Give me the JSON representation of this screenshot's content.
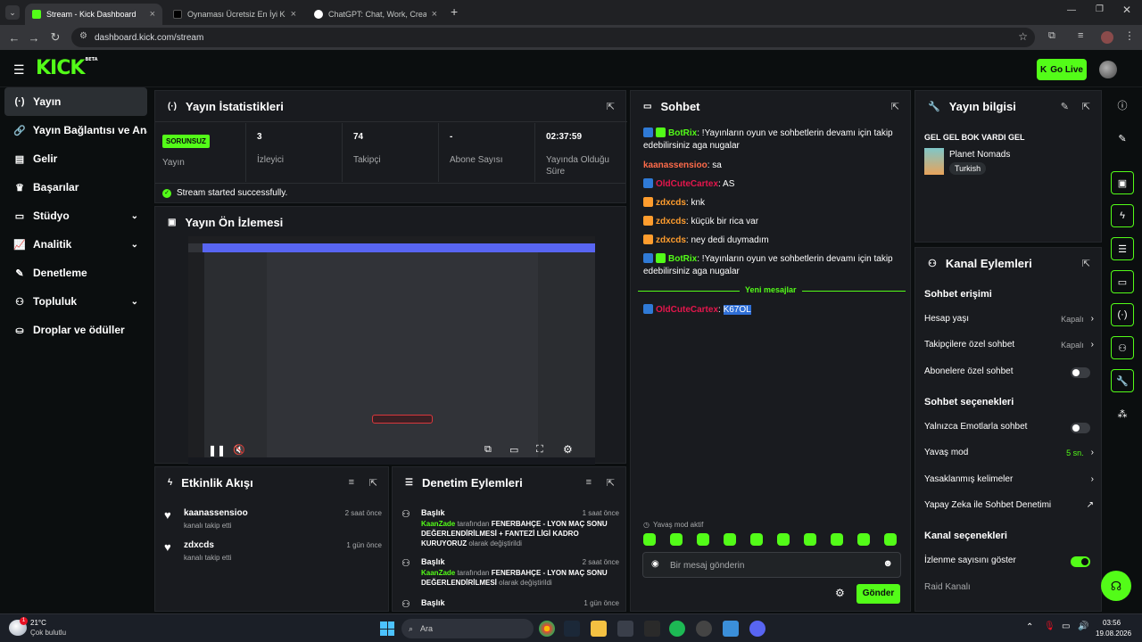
{
  "browser": {
    "tabs": [
      {
        "title": "Stream - Kick Dashboard",
        "active": true,
        "color": "#53fc18"
      },
      {
        "title": "Oynaması Ücretsiz En İyi Korku Oy...",
        "active": false,
        "color": "#111111"
      },
      {
        "title": "ChatGPT: Chat, Work, Create & Lea...",
        "active": false,
        "color": "#ffffff"
      }
    ],
    "url": "dashboard.kick.com/stream"
  },
  "header": {
    "logo": "KICK",
    "logo_badge": "BETA",
    "go_live": "Go Live",
    "accent": "#53fc18"
  },
  "sidebar": {
    "items": [
      {
        "label": "Yayın",
        "icon": "broadcast-icon",
        "glyph": "(·)",
        "active": true,
        "chevron": false
      },
      {
        "label": "Yayın Bağlantısı ve Anahtar",
        "icon": "link-icon",
        "glyph": "🔗",
        "active": false,
        "chevron": false
      },
      {
        "label": "Gelir",
        "icon": "revenue-icon",
        "glyph": "▤",
        "active": false,
        "chevron": false
      },
      {
        "label": "Başarılar",
        "icon": "trophy-icon",
        "glyph": "♛",
        "active": false,
        "chevron": false
      },
      {
        "label": "Stüdyo",
        "icon": "studio-icon",
        "glyph": "▭",
        "active": false,
        "chevron": true
      },
      {
        "label": "Analitik",
        "icon": "analytics-icon",
        "glyph": "📈",
        "active": false,
        "chevron": true
      },
      {
        "label": "Denetleme",
        "icon": "moderation-icon",
        "glyph": "✎",
        "active": false,
        "chevron": false
      },
      {
        "label": "Topluluk",
        "icon": "community-icon",
        "glyph": "⚇",
        "active": false,
        "chevron": true
      },
      {
        "label": "Droplar ve ödüller",
        "icon": "drops-icon",
        "glyph": "⛀",
        "active": false,
        "chevron": false
      }
    ]
  },
  "stats": {
    "title": "Yayın İstatistikleri",
    "status_badge": "SORUNSUZ",
    "items": [
      {
        "value": "",
        "label": "Yayın"
      },
      {
        "value": "3",
        "label": "İzleyici"
      },
      {
        "value": "74",
        "label": "Takipçi"
      },
      {
        "value": "-",
        "label": "Abone Sayısı"
      },
      {
        "value": "02:37:59",
        "label": "Yayında Olduğu Süre"
      }
    ],
    "success_message": "Stream started successfully."
  },
  "preview": {
    "title": "Yayın Ön İzlemesi"
  },
  "activity": {
    "title": "Etkinlik Akışı",
    "items": [
      {
        "user": "kaanassensioo",
        "action": "kanalı takip etti",
        "time": "2 saat önce"
      },
      {
        "user": "zdxcds",
        "action": "kanalı takip etti",
        "time": "1 gün önce"
      }
    ]
  },
  "moderation": {
    "title": "Denetim Eylemleri",
    "items": [
      {
        "heading": "Başlık",
        "time": "1 saat önce",
        "actor": "KaanZade",
        "by": " tarafından ",
        "subject": "FENERBAHÇE - LYON MAÇ SONU DEĞERLENDİRİLMESİ + FANTEZİ LİGİ KADRO KURUYORUZ",
        "suffix": " olarak değiştirildi"
      },
      {
        "heading": "Başlık",
        "time": "2 saat önce",
        "actor": "KaanZade",
        "by": " tarafından ",
        "subject": "FENERBAHÇE - LYON MAÇ SONU DEĞERLENDİRİLMESİ",
        "suffix": " olarak değiştirildi"
      },
      {
        "heading": "Başlık",
        "time": "1 gün önce",
        "actor": "",
        "by": "",
        "subject": "",
        "suffix": ""
      }
    ]
  },
  "chat": {
    "title": "Sohbet",
    "messages": [
      {
        "user": "BotRix",
        "color": "#53fc18",
        "badges": [
          "mod",
          "verified"
        ],
        "text": "!Yayınların oyun ve sohbetlerin devamı için takip edebilirsiniz aga nugalar"
      },
      {
        "user": "kaanassensioo",
        "color": "#ff6b4a",
        "badges": [],
        "text": "sa"
      },
      {
        "user": "OldCuteCartex",
        "color": "#e4164c",
        "badges": [
          "mod"
        ],
        "text": "AS"
      },
      {
        "user": "zdxcds",
        "color": "#ff9d2e",
        "badges": [
          "sub"
        ],
        "text": "knk"
      },
      {
        "user": "zdxcds",
        "color": "#ff9d2e",
        "badges": [
          "sub"
        ],
        "text": "küçük bir rica var"
      },
      {
        "user": "zdxcds",
        "color": "#ff9d2e",
        "badges": [
          "sub"
        ],
        "text": "ney dedi duymadım"
      },
      {
        "user": "BotRix",
        "color": "#53fc18",
        "badges": [
          "mod",
          "verified"
        ],
        "text": "!Yayınların oyun ve sohbetlerin devamı için takip edebilirsiniz aga nugalar"
      }
    ],
    "new_messages_label": "Yeni mesajlar",
    "new_messages": [
      {
        "user": "OldCuteCartex",
        "color": "#e4164c",
        "badges": [
          "mod"
        ],
        "text": "K67OL"
      }
    ],
    "slow_mode_notice": "Yavaş mod aktif",
    "input_placeholder": "Bir mesaj gönderin",
    "send_label": "Gönder"
  },
  "stream_info": {
    "title": "Yayın bilgisi",
    "stream_title": "GEL GEL BOK VARDI GEL",
    "category": "Planet Nomads",
    "language_tag": "Turkish"
  },
  "channel_actions": {
    "title": "Kanal Eylemleri",
    "chat_access_heading": "Sohbet erişimi",
    "account_age": {
      "label": "Hesap yaşı",
      "value": "Kapalı"
    },
    "followers_only": {
      "label": "Takipçilere özel sohbet",
      "value": "Kapalı"
    },
    "subs_only": {
      "label": "Abonelere özel sohbet",
      "on": false
    },
    "chat_options_heading": "Sohbet seçenekleri",
    "emote_only": {
      "label": "Yalnızca Emotlarla sohbet",
      "on": false
    },
    "slow_mode": {
      "label": "Yavaş mod",
      "value": "5 sn."
    },
    "banned_words": {
      "label": "Yasaklanmış kelimeler"
    },
    "ai_moderation": {
      "label": "Yapay Zeka ile Sohbet Denetimi"
    },
    "channel_options_heading": "Kanal seçenekleri",
    "show_viewers": {
      "label": "İzlenme sayısını göster",
      "on": true
    },
    "raid": {
      "label": "Raid Kanalı"
    }
  },
  "taskbar": {
    "weather_temp": "21°C",
    "weather_desc": "Çok bulutlu",
    "search_placeholder": "Ara",
    "time": "03:56",
    "date": "19.08.2026",
    "notification_count": "1"
  }
}
